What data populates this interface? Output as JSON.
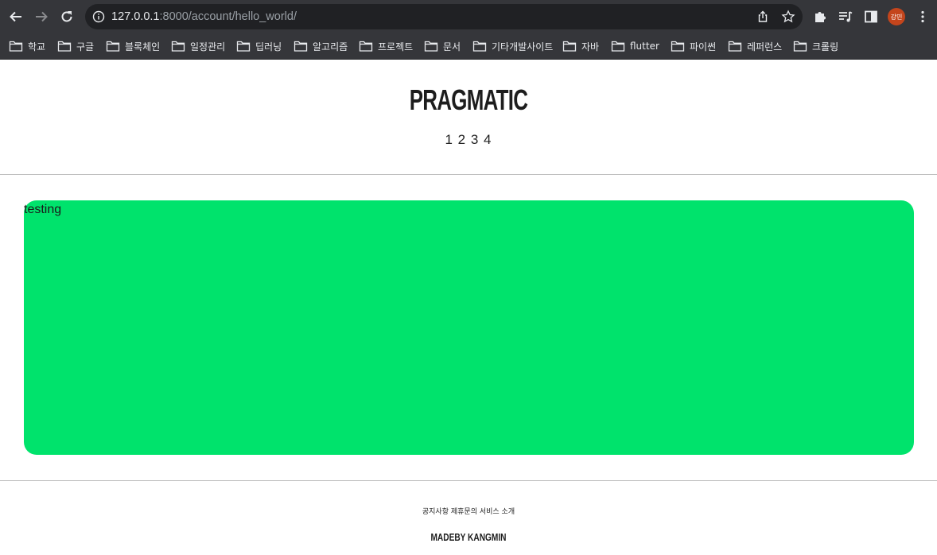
{
  "browser": {
    "url_host": "127.0.0.1",
    "url_rest": ":8000/account/hello_world/",
    "profile_initials": "강민",
    "bookmarks": [
      "학교",
      "구글",
      "블록체인",
      "일정관리",
      "딥러닝",
      "알고리즘",
      "프로젝트",
      "문서",
      "기타개발사이트",
      "자바",
      "flutter",
      "파이썬",
      "레퍼런스",
      "크롤링"
    ]
  },
  "header": {
    "title": "PRAGMATIC",
    "nav": "1 2 3 4"
  },
  "main": {
    "text": "testing",
    "box_color": "#00e36c"
  },
  "footer": {
    "links": "공지사항 제휴문의 서비스 소개",
    "credit": "MADEBY KANGMIN"
  }
}
